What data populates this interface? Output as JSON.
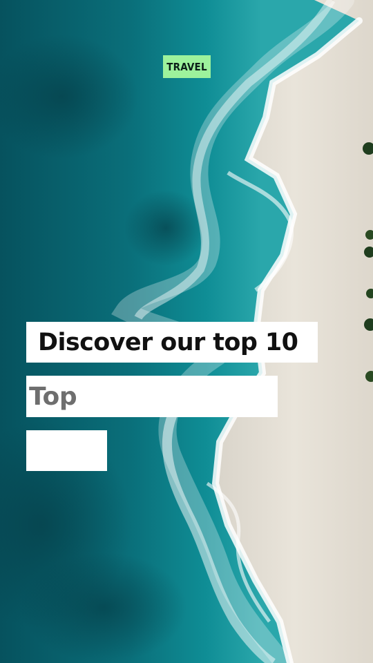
{
  "badge": {
    "label": "TRAVEL",
    "color": "#9df29c"
  },
  "headline": {
    "line1": "Discover our top 10",
    "line2": "Top"
  },
  "colors": {
    "ocean": "#0a6f7a",
    "sand": "#e7e1d6",
    "foam": "#ffffff"
  }
}
